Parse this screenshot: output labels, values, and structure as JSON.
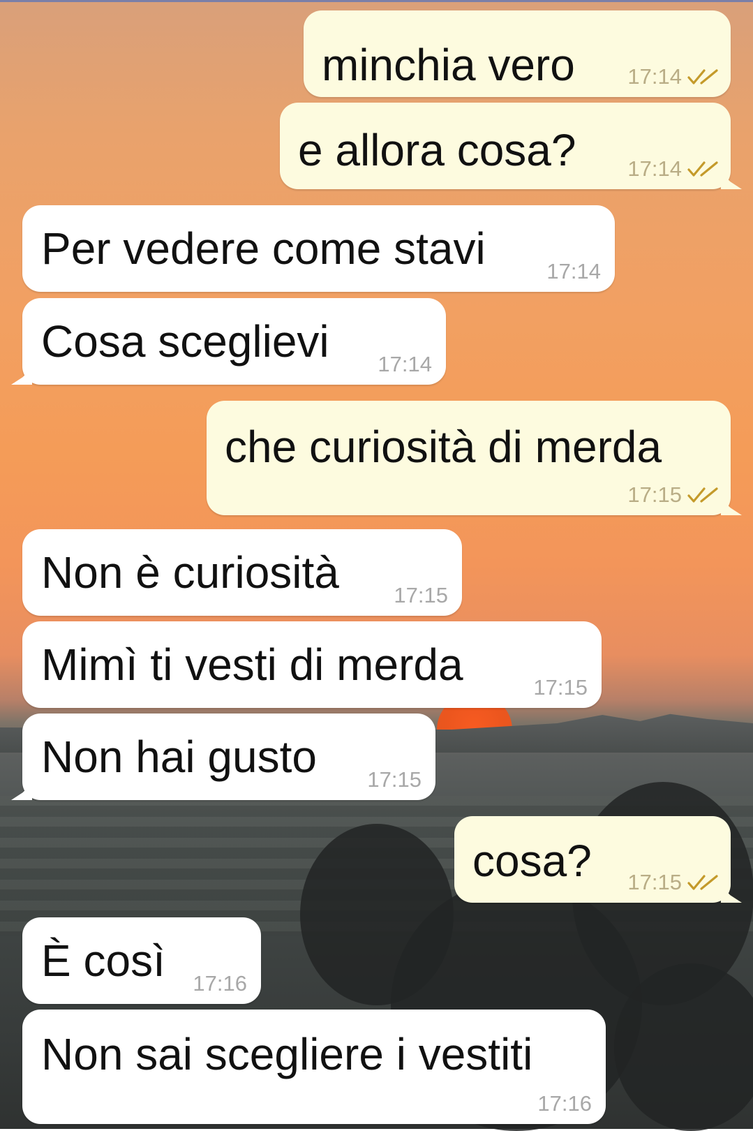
{
  "colors": {
    "outgoing_bubble": "#fdfbdf",
    "incoming_bubble": "#ffffff",
    "text": "#111111",
    "outgoing_time": "#b9ad86",
    "incoming_time": "#a8a8a8",
    "read_ticks": "#c49a2a"
  },
  "messages": [
    {
      "direction": "out",
      "text": "minchia vero",
      "time": "17:14",
      "status_icon": "double-check-icon"
    },
    {
      "direction": "out",
      "text": "e allora cosa?",
      "time": "17:14",
      "status_icon": "double-check-icon"
    },
    {
      "direction": "in",
      "text": "Per vedere come stavi",
      "time": "17:14"
    },
    {
      "direction": "in",
      "text": "Cosa sceglievi",
      "time": "17:14"
    },
    {
      "direction": "out",
      "text": "che curiosità di merda",
      "time": "17:15",
      "status_icon": "double-check-icon"
    },
    {
      "direction": "in",
      "text": "Non è curiosità",
      "time": "17:15"
    },
    {
      "direction": "in",
      "text": "Mimì ti vesti di merda",
      "time": "17:15"
    },
    {
      "direction": "in",
      "text": "Non hai gusto",
      "time": "17:15"
    },
    {
      "direction": "out",
      "text": "cosa?",
      "time": "17:15",
      "status_icon": "double-check-icon"
    },
    {
      "direction": "in",
      "text": "È così",
      "time": "17:16"
    },
    {
      "direction": "in",
      "text": "Non sai scegliere i vestiti",
      "time": "17:16"
    }
  ]
}
